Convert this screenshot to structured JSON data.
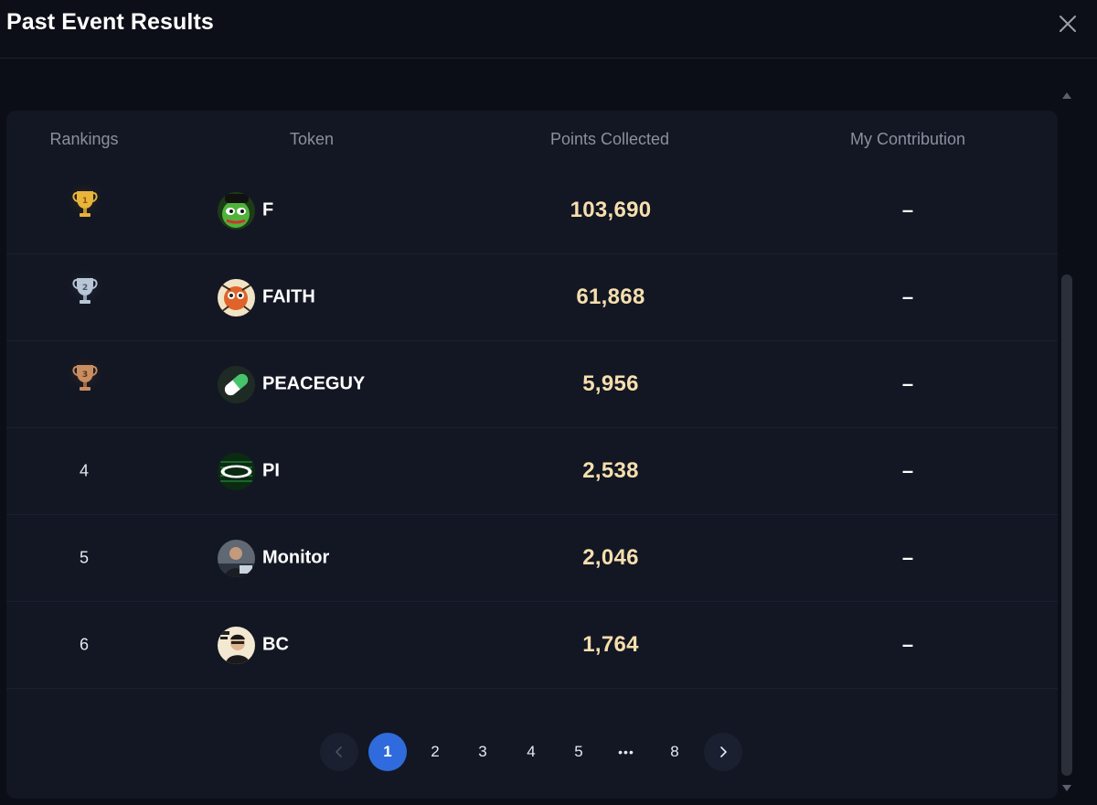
{
  "dialog": {
    "title": "Past Event Results"
  },
  "table": {
    "columns": [
      "Rankings",
      "Token",
      "Points Collected",
      "My Contribution"
    ],
    "rows": [
      {
        "rank": "1",
        "token": "F",
        "points": "103,690",
        "contribution": "–",
        "trophy": "gold"
      },
      {
        "rank": "2",
        "token": "FAITH",
        "points": "61,868",
        "contribution": "–",
        "trophy": "silver"
      },
      {
        "rank": "3",
        "token": "PEACEGUY",
        "points": "5,956",
        "contribution": "–",
        "trophy": "bronze"
      },
      {
        "rank": "4",
        "token": "PI",
        "points": "2,538",
        "contribution": "–"
      },
      {
        "rank": "5",
        "token": "Monitor",
        "points": "2,046",
        "contribution": "–"
      },
      {
        "rank": "6",
        "token": "BC",
        "points": "1,764",
        "contribution": "–"
      }
    ]
  },
  "pagination": {
    "pages": [
      "1",
      "2",
      "3",
      "4",
      "5",
      "8"
    ],
    "current": "1",
    "ellipsis": "•••"
  },
  "colors": {
    "background": "#0b0e17",
    "panel": "#131723",
    "accent": "#2f6bdc",
    "points": "#f6dfae",
    "gold": "#e9b43a",
    "silver": "#b9c6d6",
    "bronze": "#c98d62"
  },
  "icons": {
    "close": "close-icon",
    "prev": "chevron-left-icon",
    "next": "chevron-right-icon",
    "scroll_up": "triangle-up-icon",
    "scroll_down": "triangle-down-icon"
  }
}
